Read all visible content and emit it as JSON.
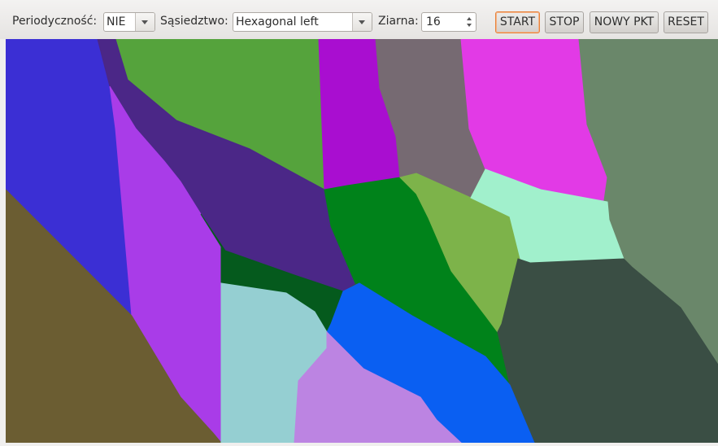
{
  "toolbar": {
    "periodicity_label": "Periodyczność:",
    "periodicity_value": "NIE",
    "neighborhood_label": "Sąsiedztwo:",
    "neighborhood_value": "Hexagonal left",
    "grains_label": "Ziarna:",
    "grains_value": "16",
    "start_label": "START",
    "stop_label": "STOP",
    "new_point_label": "NOWY PKT",
    "reset_label": "RESET"
  },
  "icons": {
    "periodicity_dropdown": "chevron-down-icon",
    "neighborhood_dropdown": "chevron-down-icon",
    "grains_increment": "spin-up-icon",
    "grains_decrement": "spin-down-icon"
  },
  "grains": [
    {
      "color": "#3b2fd4"
    },
    {
      "color": "#55a33c"
    },
    {
      "color": "#4b2787"
    },
    {
      "color": "#a90ed0"
    },
    {
      "color": "#766a72"
    },
    {
      "color": "#e23ae6"
    },
    {
      "color": "#6a876a"
    },
    {
      "color": "#a93ce8"
    },
    {
      "color": "#6b5d32"
    },
    {
      "color": "#055a1d"
    },
    {
      "color": "#00821a"
    },
    {
      "color": "#7db34a"
    },
    {
      "color": "#a1f0cc"
    },
    {
      "color": "#3a4e44"
    },
    {
      "color": "#0a5ff2"
    },
    {
      "color": "#95cfd2"
    },
    {
      "color": "#bc84e2"
    }
  ]
}
